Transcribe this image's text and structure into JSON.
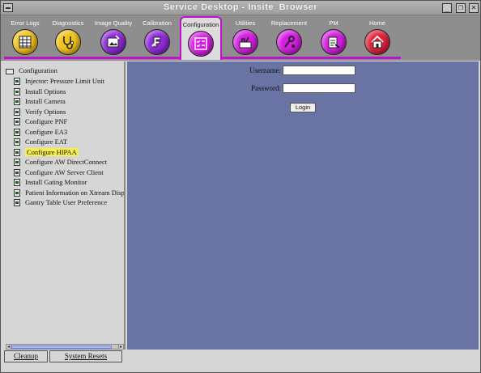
{
  "window": {
    "title": "Service Desktop - Insite_Browser",
    "buttons": {
      "minimize": "_",
      "restore": "❐",
      "close": "✕"
    }
  },
  "toolbar": {
    "items": [
      {
        "label": "Error Logs",
        "icon": "grid-icon",
        "color": "#f2c21a"
      },
      {
        "label": "Diagnostics",
        "icon": "stethoscope-icon",
        "color": "#f2c21a"
      },
      {
        "label": "Image Quality",
        "icon": "image-quality-icon",
        "color": "#8f2ad8"
      },
      {
        "label": "Calibration",
        "icon": "calibration-icon",
        "color": "#8f2ad8"
      },
      {
        "label": "Configuration",
        "icon": "checklist-icon",
        "color": "#d41ee0",
        "active": true
      },
      {
        "label": "Utilities",
        "icon": "utilities-icon",
        "color": "#d41ee0"
      },
      {
        "label": "Replacement",
        "icon": "wrench-icon",
        "color": "#d41ee0"
      },
      {
        "label": "PM",
        "icon": "pm-icon",
        "color": "#d41ee0"
      },
      {
        "label": "Home",
        "icon": "home-icon",
        "color": "#e0213a"
      }
    ]
  },
  "tree": {
    "root": "Configuration",
    "items": [
      "Injector: Pressure Limit Unit",
      "Install Options",
      "Install Camera",
      "Verify Options",
      "Configure PNF",
      "Configure EA3",
      "Configure EAT",
      "Configure HIPAA",
      "Configure AW DirectConnect",
      "Configure AW Server Client",
      "Install Gating Monitor",
      "Patient Information on Xtream Disp",
      "Gantry Table User Preference"
    ],
    "selected": "Configure HIPAA"
  },
  "login": {
    "username_label": "Username:",
    "password_label": "Password:",
    "username_value": "",
    "password_value": "",
    "button_label": "Login"
  },
  "bottom": {
    "cleanup_label": "Cleanup",
    "system_resets_label": "System Resets"
  },
  "colors": {
    "content_bg": "#6a74a4",
    "accent": "#c013c9",
    "highlight": "#f7f04a"
  }
}
